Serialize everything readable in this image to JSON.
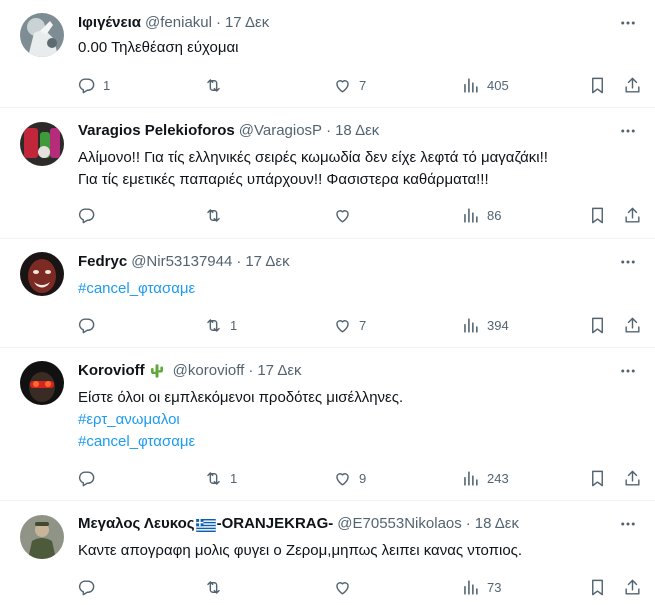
{
  "icons": {
    "reply": "reply-icon",
    "retweet": "retweet-icon",
    "like": "like-icon",
    "views": "views-icon",
    "bookmark": "bookmark-icon",
    "share": "share-icon",
    "more": "more-icon"
  },
  "colors": {
    "link": "#1d9bf0",
    "muted": "#536471",
    "text": "#0f1419",
    "divider": "#eff3f4"
  },
  "tweets": [
    {
      "name": "Ιφιγένεια",
      "handle": "@feniakul",
      "separator": "·",
      "time": "17 Δεκ",
      "lines": [
        "0.00 Τηλεθέαση εύχομαι"
      ],
      "replies": "1",
      "retweets": "",
      "likes": "7",
      "views": "405"
    },
    {
      "name": "Varagios Pelekioforos",
      "handle": "@VaragiosP",
      "separator": "·",
      "time": "18 Δεκ",
      "lines": [
        "Αλίμονο!! Για τίς ελληνικές σειρές κωμωδία δεν είχε λεφτά τό μαγαζάκι!!",
        "Για τίς εμετικές παπαριές υπάρχουν!! Φασιστερα καθάρματα!!!"
      ],
      "replies": "",
      "retweets": "",
      "likes": "",
      "views": "86"
    },
    {
      "name": "Fedryc",
      "handle": "@Nir53137944",
      "separator": "·",
      "time": "17 Δεκ",
      "lines": [],
      "hashtags": [
        "#cancel_φτασαμε"
      ],
      "replies": "",
      "retweets": "1",
      "likes": "7",
      "views": "394"
    },
    {
      "name": "Korovioff",
      "handle": "@korovioff",
      "separator": "·",
      "time": "17 Δεκ",
      "lines": [
        "Είστε όλοι οι εμπλεκόμενοι προδότες μισέλληνες."
      ],
      "hashtags": [
        "#ερτ_ανωμαλοι",
        "#cancel_φτασαμε"
      ],
      "replies": "",
      "retweets": "1",
      "likes": "9",
      "views": "243"
    },
    {
      "name_part1": "Μεγαλος Λευκος",
      "name_part2": "-ORANJEKRAG-",
      "handle": "@E70553Nikolaos",
      "separator": "·",
      "time": "18 Δεκ",
      "lines": [
        "Καντε απογραφη μολις φυγει ο Ζερομ,μηπως λειπει κανας ντοπιος."
      ],
      "replies": "",
      "retweets": "",
      "likes": "",
      "views": "73"
    }
  ]
}
